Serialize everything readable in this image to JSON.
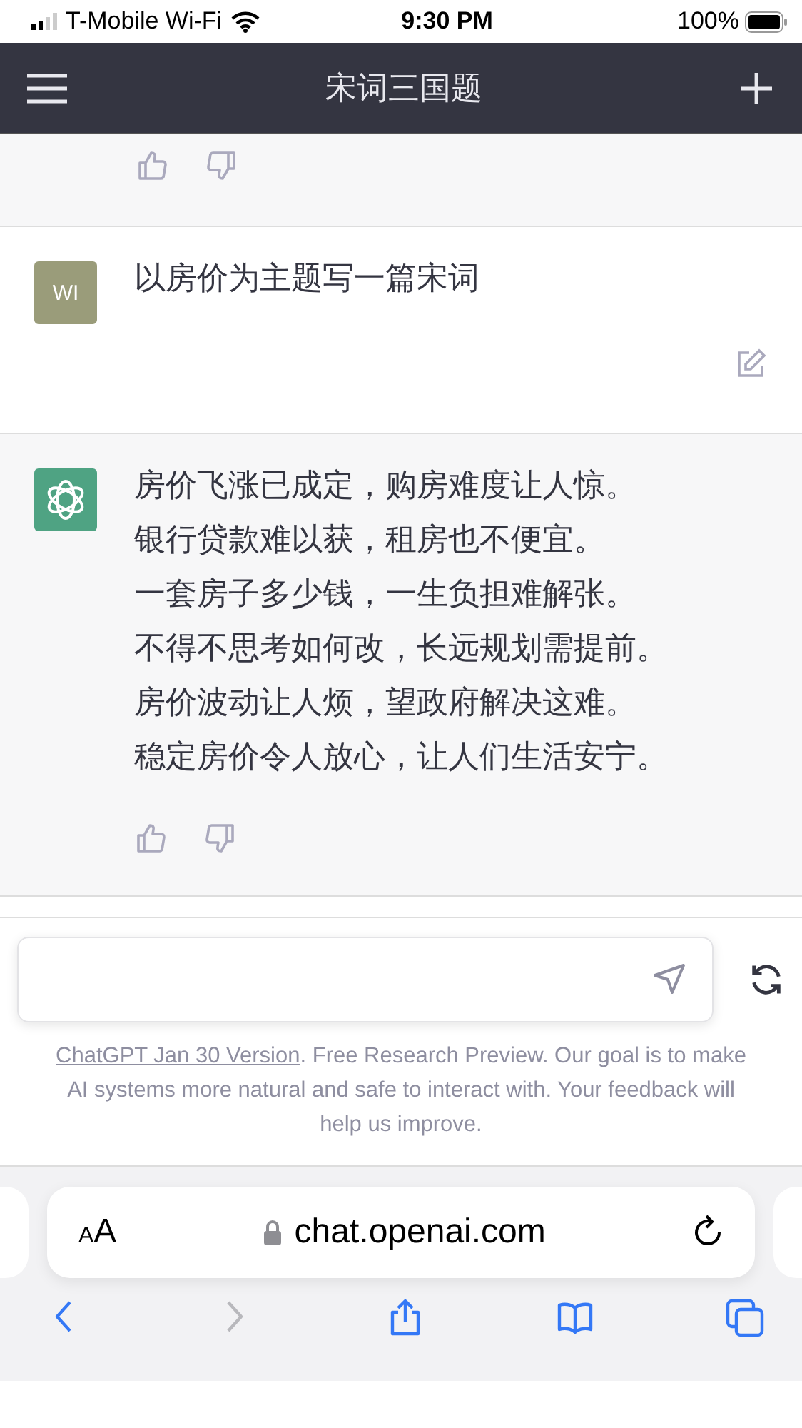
{
  "status_bar": {
    "carrier": "T-Mobile Wi-Fi",
    "time": "9:30 PM",
    "battery": "100%"
  },
  "header": {
    "title": "宋词三国题"
  },
  "messages": [
    {
      "kind": "assistant",
      "feedback": true
    },
    {
      "kind": "user",
      "avatar": "WI",
      "lines": [
        "以房价为主题写一篇宋词"
      ]
    },
    {
      "kind": "assistant",
      "lines": [
        "房价飞涨已成定，购房难度让人惊。",
        "银行贷款难以获，租房也不便宜。",
        "一套房子多少钱，一生负担难解张。",
        "不得不思考如何改，长远规划需提前。",
        "房价波动让人烦，望政府解决这难。",
        "稳定房价令人放心，让人们生活安宁。"
      ],
      "feedback": true
    }
  ],
  "composer": {
    "link": "ChatGPT Jan 30 Version",
    "text": ". Free Research Preview. Our goal is to make AI systems more natural and safe to interact with. Your feedback will help us improve."
  },
  "browser": {
    "text_size": "AA",
    "url": "chat.openai.com",
    "nav": [
      {
        "kind": "back",
        "disabled": false
      },
      {
        "kind": "forward",
        "disabled": true
      },
      {
        "kind": "share",
        "disabled": false
      },
      {
        "kind": "bookmarks",
        "disabled": false
      },
      {
        "kind": "tabs",
        "disabled": false
      }
    ]
  }
}
